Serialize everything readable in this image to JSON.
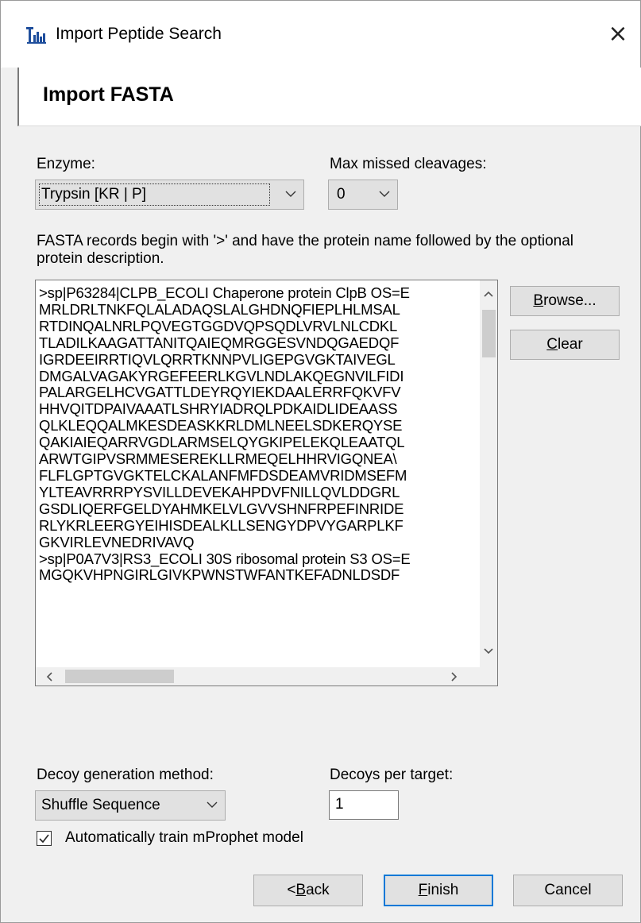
{
  "window": {
    "title": "Import Peptide Search",
    "close_symbol": "×"
  },
  "header": {
    "title": "Import FASTA"
  },
  "enzyme": {
    "label": "Enzyme:",
    "value": "Trypsin [KR | P]"
  },
  "missed_cleavages": {
    "label": "Max missed cleavages:",
    "value": "0"
  },
  "fasta": {
    "description": "FASTA records begin with '>' and have the protein name followed by the optional protein description.",
    "lines": [
      ">sp|P63284|CLPB_ECOLI Chaperone protein ClpB OS=E",
      "MRLDRLTNKFQLALADAQSLALGHDNQFIEPLHLMSAL",
      "RTDINQALNRLPQVEGTGGDVQPSQDLVRVLNLCDKL",
      "TLADILKAAGATTANITQAIEQMRGGESVNDQGAEDQF",
      "IGRDEEIRRTIQVLQRRTKNNPVLIGEPGVGKTAIVEGL",
      "DMGALVAGAKYRGEFEERLKGVLNDLAKQEGNVILFIDI",
      "PALARGELHCVGATTLDEYRQYIEKDAALERRFQKVFV",
      "HHVQITDPAIVAAATLSHRYIADRQLPDKAIDLIDEAASS",
      "QLKLEQQALMKESDEASKKRLDMLNEELSDKERQYSE",
      "QAKIAIEQARRVGDLARMSELQYGKIPELEKQLEAATQL",
      "ARWTGIPVSRMMESEREKLLRMEQELHHRVIGQNEA\\",
      "FLFLGPTGVGKTELCKALANFMFDSDEAMVRIDMSEFM",
      "YLTEAVRRRPYSVILLDEVEKAHPDVFNILLQVLDDGRL",
      "GSDLIQERFGELDYAHMKELVLGVVSHNFRPEFINRIDE",
      "RLYKRLEERGYEIHISDEALKLLSENGYDPVYGARPLKF",
      "GKVIRLEVNEDRIVAVQ",
      ">sp|P0A7V3|RS3_ECOLI 30S ribosomal protein S3 OS=E",
      "MGQKVHPNGIRLGIVKPWNSTWFANTKEFADNLDSDF"
    ]
  },
  "buttons": {
    "browse_pre": "",
    "browse_key": "B",
    "browse_post": "rowse...",
    "clear_pre": "",
    "clear_key": "C",
    "clear_post": "lear",
    "back_pre": "< ",
    "back_key": "B",
    "back_post": "ack",
    "finish_pre": "",
    "finish_key": "F",
    "finish_post": "inish",
    "cancel": "Cancel"
  },
  "decoy": {
    "method_label": "Decoy generation method:",
    "method_value": "Shuffle Sequence",
    "per_target_label": "Decoys per target:",
    "per_target_value": "1"
  },
  "train_mprophet": {
    "label": "Automatically train mProphet model",
    "checked": true
  },
  "colors": {
    "accent": "#0078d7",
    "button_face": "#e1e1e1",
    "window_bg": "#f0f0f0"
  },
  "icons": {
    "app": "peptide-app-icon",
    "close": "close-icon",
    "dropdown": "chevron-down-icon",
    "check": "checkmark-icon"
  }
}
